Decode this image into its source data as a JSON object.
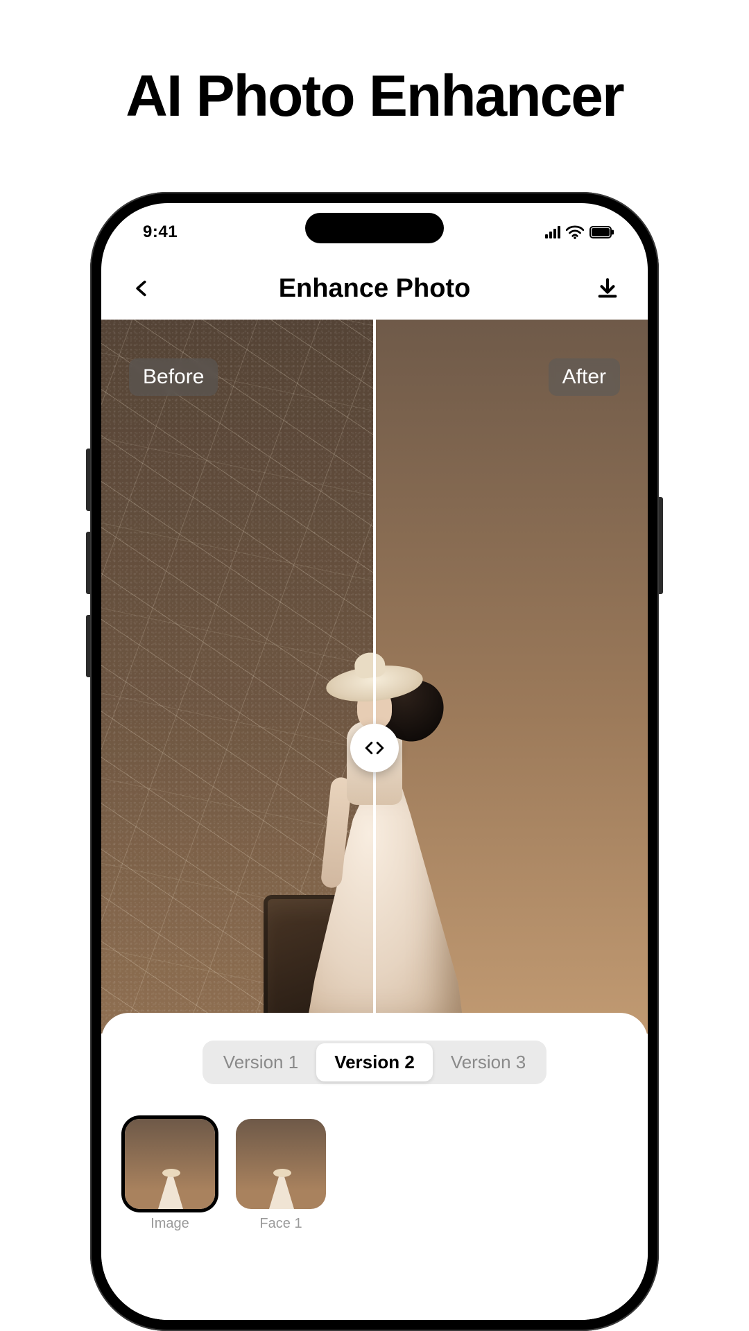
{
  "hero": {
    "title": "AI Photo Enhancer"
  },
  "status": {
    "time": "9:41"
  },
  "nav": {
    "title": "Enhance Photo"
  },
  "compare": {
    "before_label": "Before",
    "after_label": "After"
  },
  "versions": {
    "items": [
      {
        "label": "Version 1",
        "active": false
      },
      {
        "label": "Version 2",
        "active": true
      },
      {
        "label": "Version 3",
        "active": false
      }
    ]
  },
  "thumbnails": {
    "items": [
      {
        "label": "Image",
        "selected": true
      },
      {
        "label": "Face 1",
        "selected": false
      }
    ]
  }
}
